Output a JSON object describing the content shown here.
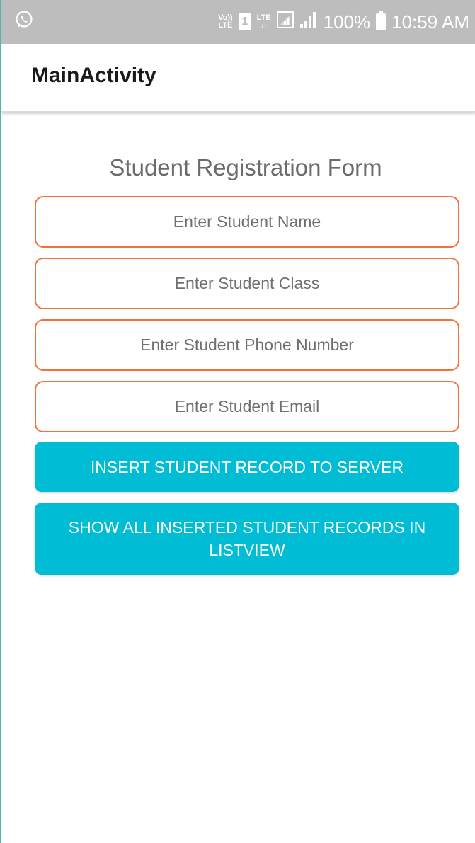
{
  "status_bar": {
    "left_icon": "whatsapp-icon",
    "volte_top": "Vo))",
    "volte_bottom": "LTE",
    "sim_slot": "1",
    "lte_label": "LTE",
    "battery_percent": "100%",
    "time": "10:59 AM"
  },
  "toolbar": {
    "title": "MainActivity"
  },
  "form": {
    "title": "Student Registration Form",
    "fields": [
      {
        "placeholder": "Enter Student Name",
        "value": ""
      },
      {
        "placeholder": "Enter Student Class",
        "value": ""
      },
      {
        "placeholder": "Enter Student Phone Number",
        "value": ""
      },
      {
        "placeholder": "Enter Student Email",
        "value": ""
      }
    ],
    "insert_button_label": "INSERT STUDENT RECORD TO SERVER",
    "show_button_label": "SHOW ALL INSERTED STUDENT RECORDS IN LISTVIEW"
  },
  "colors": {
    "accent": "#00bcd4",
    "field_border": "#f0733a",
    "status_bar": "#bdbdbd"
  }
}
